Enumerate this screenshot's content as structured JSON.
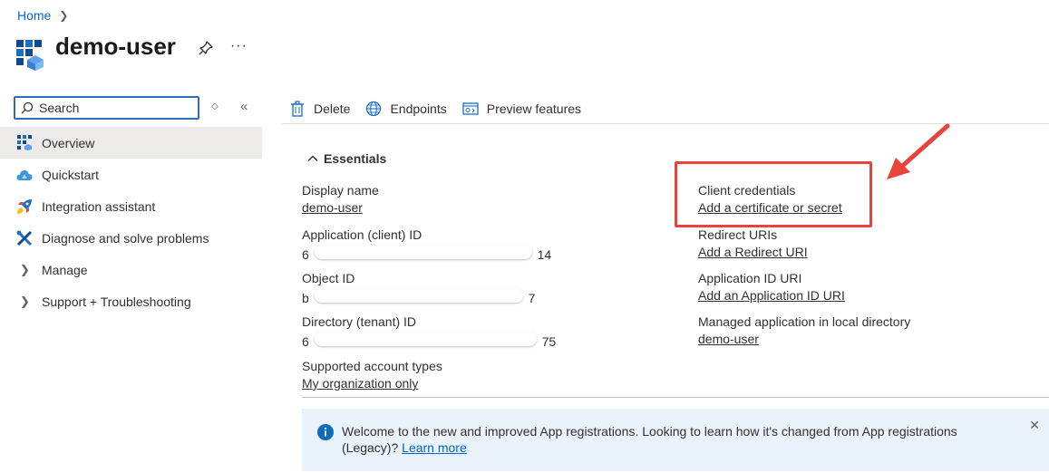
{
  "breadcrumb": {
    "home": "Home"
  },
  "header": {
    "title": "demo-user",
    "more": "···"
  },
  "sidebar": {
    "search_placeholder": "Search",
    "items": [
      {
        "label": "Overview",
        "icon": "grid-icon",
        "active": true
      },
      {
        "label": "Quickstart",
        "icon": "cloud-icon"
      },
      {
        "label": "Integration assistant",
        "icon": "rocket-icon"
      },
      {
        "label": "Diagnose and solve problems",
        "icon": "wrench-icon"
      },
      {
        "label": "Manage",
        "icon": "chevron-right-icon"
      },
      {
        "label": "Support + Troubleshooting",
        "icon": "chevron-right-icon"
      }
    ]
  },
  "toolbar": {
    "delete": "Delete",
    "endpoints": "Endpoints",
    "preview": "Preview features"
  },
  "essentials": {
    "title": "Essentials",
    "left": {
      "display_name_label": "Display name",
      "display_name_value": "demo-user",
      "app_id_label": "Application (client) ID",
      "app_id_prefix": "6",
      "app_id_suffix": "14",
      "object_id_label": "Object ID",
      "object_id_prefix": "b",
      "object_id_suffix": "7",
      "tenant_id_label": "Directory (tenant) ID",
      "tenant_id_prefix": "6",
      "tenant_id_suffix": "75",
      "account_types_label": "Supported account types",
      "account_types_value": "My organization only"
    },
    "right": {
      "client_credentials_label": "Client credentials",
      "client_credentials_value": "Add a certificate or secret",
      "redirect_label": "Redirect URIs",
      "redirect_value": "Add a Redirect URI",
      "app_id_uri_label": "Application ID URI",
      "app_id_uri_value": "Add an Application ID URI",
      "managed_label": "Managed application in local directory",
      "managed_value": "demo-user"
    }
  },
  "banner": {
    "message": "Welcome to the new and improved App registrations. Looking to learn how it's changed from App registrations (Legacy)? ",
    "link_part1": "Learn",
    "link_part2": "more"
  },
  "colors": {
    "accent": "#0066cc",
    "highlight": "#e8443a",
    "banner_bg": "#eaf3fc"
  }
}
